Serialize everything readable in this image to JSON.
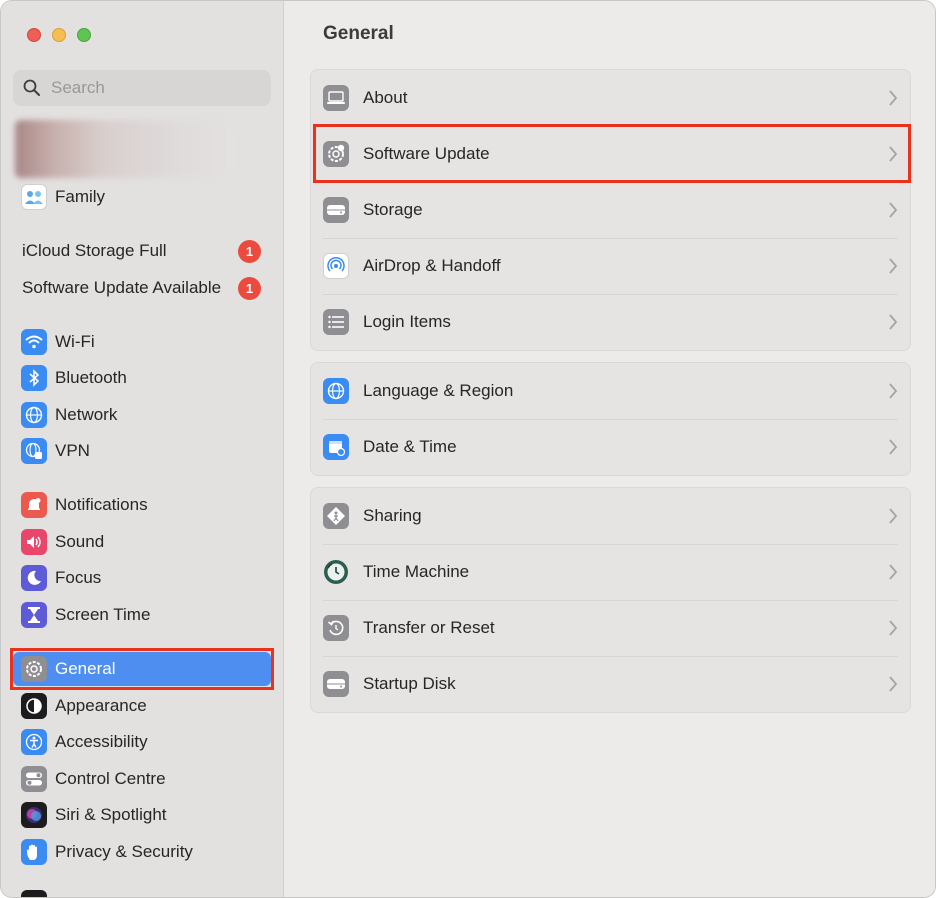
{
  "sidebar": {
    "search_placeholder": "Search",
    "family": "Family",
    "alerts": [
      {
        "label": "iCloud Storage Full",
        "badge": "1"
      },
      {
        "label": "Software Update Available",
        "badge": "1"
      }
    ],
    "items": [
      {
        "label": "Wi-Fi",
        "icon": "wifi-icon"
      },
      {
        "label": "Bluetooth",
        "icon": "bluetooth-icon"
      },
      {
        "label": "Network",
        "icon": "network-icon"
      },
      {
        "label": "VPN",
        "icon": "vpn-icon"
      },
      {
        "label": "Notifications",
        "icon": "bell-icon"
      },
      {
        "label": "Sound",
        "icon": "speaker-icon"
      },
      {
        "label": "Focus",
        "icon": "moon-icon"
      },
      {
        "label": "Screen Time",
        "icon": "hourglass-icon"
      },
      {
        "label": "General",
        "icon": "gear-icon"
      },
      {
        "label": "Appearance",
        "icon": "appearance-icon"
      },
      {
        "label": "Accessibility",
        "icon": "accessibility-icon"
      },
      {
        "label": "Control Centre",
        "icon": "control-centre-icon"
      },
      {
        "label": "Siri & Spotlight",
        "icon": "siri-icon"
      },
      {
        "label": "Privacy & Security",
        "icon": "hand-icon"
      }
    ],
    "selected": "General"
  },
  "main": {
    "title": "General",
    "groups": [
      [
        {
          "label": "About",
          "icon": "laptop-icon"
        },
        {
          "label": "Software Update",
          "icon": "gear-badge-icon"
        },
        {
          "label": "Storage",
          "icon": "drive-icon"
        },
        {
          "label": "AirDrop & Handoff",
          "icon": "airdrop-icon"
        },
        {
          "label": "Login Items",
          "icon": "list-icon"
        }
      ],
      [
        {
          "label": "Language & Region",
          "icon": "globe-icon"
        },
        {
          "label": "Date & Time",
          "icon": "calendar-clock-icon"
        }
      ],
      [
        {
          "label": "Sharing",
          "icon": "sharing-icon"
        },
        {
          "label": "Time Machine",
          "icon": "time-machine-icon"
        },
        {
          "label": "Transfer or Reset",
          "icon": "reset-icon"
        },
        {
          "label": "Startup Disk",
          "icon": "startup-disk-icon"
        }
      ]
    ]
  },
  "colors": {
    "accent": "#4e8ef0",
    "badge": "#eb4b3f",
    "highlight_box": "#e8321d"
  }
}
